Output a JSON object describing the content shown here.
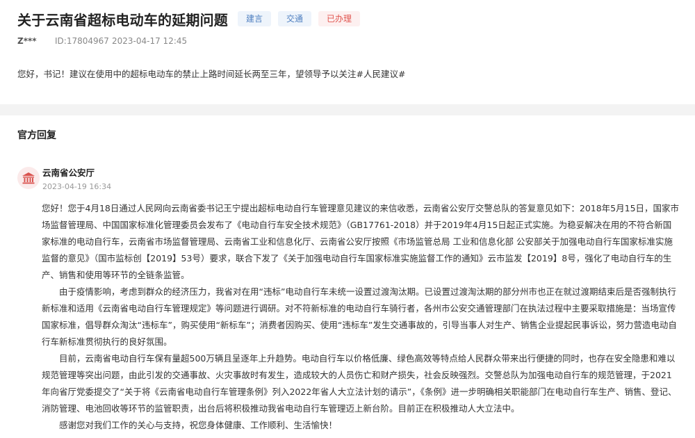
{
  "post": {
    "title": "关于云南省超标电动车的延期问题",
    "tags": [
      {
        "label": "建言",
        "color": "#4f7fc0"
      },
      {
        "label": "交通",
        "color": "#4f7fc0"
      },
      {
        "label": "已办理",
        "color": "#e0554f"
      }
    ],
    "user": "Z***",
    "id": "ID:17804967",
    "time": "2023-04-17 12:45",
    "question": "您好，书记！建议在使用中的超标电动车的禁止上路时间延长两至三年，望领导予以关注#人民建议#"
  },
  "reply": {
    "heading": "官方回复",
    "org_name": "云南省公安厅",
    "org_icon": "government-building-icon",
    "time": "2023-04-19 16:34",
    "paragraphs": [
      "您好！您于4月18日通过人民网向云南省委书记王宁提出超标电动自行车管理意见建议的来信收悉，云南省公安厅交警总队的答复意见如下：2018年5月15日，国家市场监督管理局、中国国家标准化管理委员会发布了《电动自行车安全技术规范》（GB17761-2018）并于2019年4月15日起正式实施。为稳妥解决在用的不符合新国家标准的电动自行车，云南省市场监督管理局、云南省工业和信息化厅、云南省公安厅按照《市场监管总局 工业和信息化部 公安部关于加强电动自行车国家标准实施监督的意见》（国市监标创【2019】53号）要求，联合下发了《关于加强电动自行车国家标准实施监督工作的通知》云市监发【2019】8号，强化了电动自行车的生产、销售和使用等环节的全链条监管。",
      "由于疫情影响，考虑到群众的经济压力，我省对在用“违标”电动自行车未统一设置过渡淘汰期。已设置过渡淘汰期的部分州市也正在就过渡期结束后是否强制执行新标准和适用《云南省电动自行车管理规定》等问题进行调研。对不符新标准的电动自行车骑行者，各州市公安交通管理部门在执法过程中主要采取措施是：当场宣传国家标准，倡导群众淘汰“违标车”，购买使用“新标车”；消费者因购买、使用“违标车”发生交通事故的，引导当事人对生产、销售企业提起民事诉讼，努力营造电动自行车新标准贯彻执行的良好氛围。",
      "目前，云南省电动自行车保有量超500万辆且呈逐年上升趋势。电动自行车以价格低廉、绿色高效等特点给人民群众带来出行便捷的同时，也存在安全隐患和难以规范管理等突出问题，由此引发的交通事故、火灾事故时有发生，造成较大的人员伤亡和财产损失，社会反映强烈。交警总队为加强电动自行车的规范管理，于2021年向省厅党委提交了“关于将《云南省电动自行车管理条例》列入2022年省人大立法计划的请示”，《条例》进一步明确相关职能部门在电动自行车生产、销售、登记、消防管理、电池回收等环节的监管职责，出台后将积极推动我省电动自行车管理迈上新台阶。目前正在积极推动人大立法中。",
      "感谢您对我们工作的关心与支持，祝您身体健康、工作顺利、生活愉快！"
    ]
  }
}
